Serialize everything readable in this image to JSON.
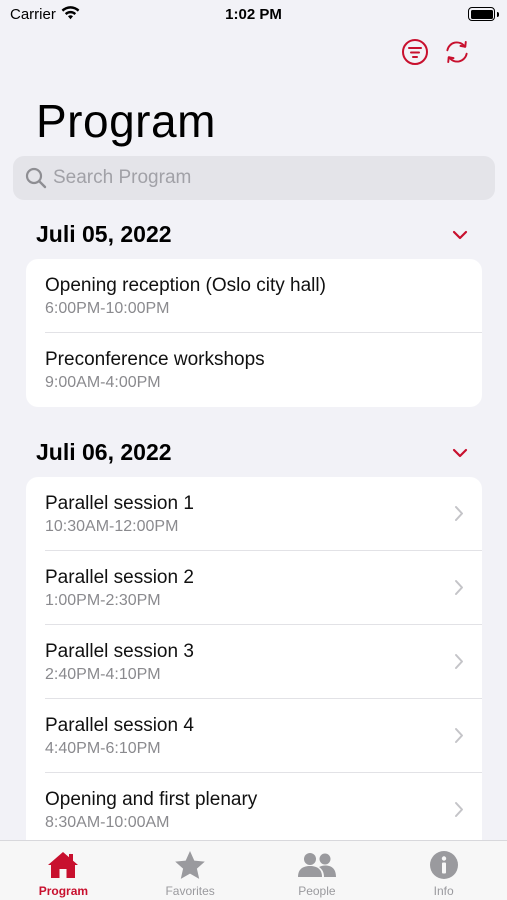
{
  "status_bar": {
    "carrier": "Carrier",
    "time": "1:02 PM"
  },
  "colors": {
    "accent": "#c8102e",
    "background": "#f2f2f7",
    "inactive": "#9a9a9e"
  },
  "header": {
    "title": "Program",
    "actions": [
      {
        "icon": "filter-icon"
      },
      {
        "icon": "refresh-icon"
      }
    ]
  },
  "search": {
    "placeholder": "Search Program",
    "value": ""
  },
  "sections": [
    {
      "date": "Juli 05, 2022",
      "expanded": true,
      "items": [
        {
          "title": "Opening reception (Oslo city hall)",
          "time": "6:00PM-10:00PM",
          "has_disclosure": false
        },
        {
          "title": "Preconference workshops",
          "time": "9:00AM-4:00PM",
          "has_disclosure": false
        }
      ]
    },
    {
      "date": "Juli 06, 2022",
      "expanded": true,
      "items": [
        {
          "title": "Parallel session 1",
          "time": "10:30AM-12:00PM",
          "has_disclosure": true
        },
        {
          "title": "Parallel session 2",
          "time": "1:00PM-2:30PM",
          "has_disclosure": true
        },
        {
          "title": "Parallel session 3",
          "time": "2:40PM-4:10PM",
          "has_disclosure": true
        },
        {
          "title": "Parallel session 4",
          "time": "4:40PM-6:10PM",
          "has_disclosure": true
        },
        {
          "title": "Opening and first plenary",
          "time": "8:30AM-10:00AM",
          "has_disclosure": true
        }
      ]
    }
  ],
  "tab_bar": {
    "tabs": [
      {
        "label": "Program",
        "icon": "home-icon",
        "active": true
      },
      {
        "label": "Favorites",
        "icon": "star-icon",
        "active": false
      },
      {
        "label": "People",
        "icon": "people-icon",
        "active": false
      },
      {
        "label": "Info",
        "icon": "info-icon",
        "active": false
      }
    ]
  }
}
